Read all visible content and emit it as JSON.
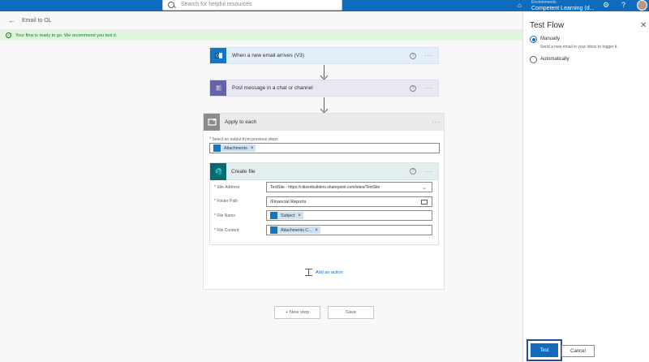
{
  "topbar": {
    "search_placeholder": "Search for helpful resources",
    "environment_name": "Competent Learning (d...",
    "environment_label": "Environments"
  },
  "header": {
    "title": "Email to OL"
  },
  "banner": {
    "text": "Your flow is ready to go. We recommend you test it."
  },
  "flow": {
    "trigger_title": "When a new email arrives (V3)",
    "teams_title": "Post message in a chat or channel",
    "apply_title": "Apply to each",
    "apply_select_label": "* Select an output from previous steps",
    "apply_token": "Attachments",
    "create_title": "Create file",
    "fields": {
      "site_label": "* Site Address",
      "site_value": "TestSite - https://citizenbuilders.sharepoint.com/sites/TestSite",
      "folder_label": "* Folder Path",
      "folder_value": "/Financial Reports",
      "filename_label": "* File Name",
      "filename_token": "Subject",
      "content_label": "* File Content",
      "content_token": "Attachments C..."
    },
    "add_action": "Add an action",
    "new_step": "+ New step",
    "save": "Save"
  },
  "panel": {
    "title": "Test Flow",
    "opt_manual": "Manually",
    "opt_manual_desc": "Send a new email in your inbox to trigger it.",
    "opt_auto": "Automatically",
    "test_label": "Test",
    "cancel_label": "Cancel"
  },
  "colors": {
    "accent": "#0f6cbd",
    "success": "#107c10"
  },
  "icons": [
    "search-icon",
    "environment-icon",
    "settings-icon",
    "help-icon",
    "back-arrow-icon",
    "check-icon",
    "outlook-icon",
    "teams-icon",
    "loop-icon",
    "sharepoint-icon",
    "folder-icon",
    "chevron-down-icon",
    "add-action-icon",
    "close-icon",
    "more-icon"
  ]
}
